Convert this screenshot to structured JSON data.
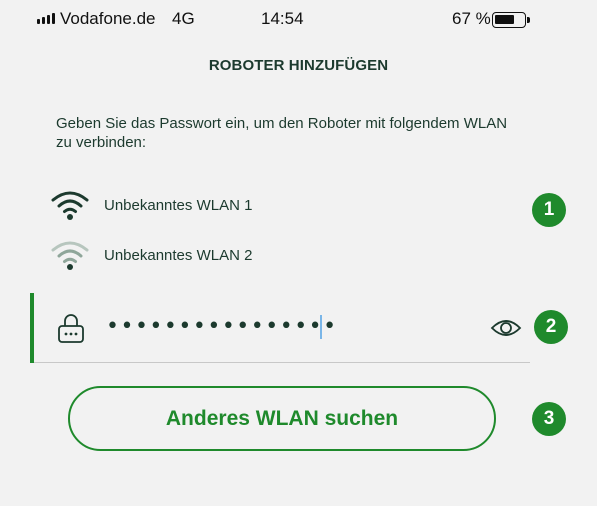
{
  "status_bar": {
    "carrier": "Vodafone.de",
    "network": "4G",
    "time": "14:54",
    "battery_percent": "67 %",
    "battery_level": 0.67
  },
  "header": {
    "title": "ROBOTER HINZUFÜGEN"
  },
  "instruction": "Geben Sie das Passwort ein, um den Roboter mit folgendem WLAN zu verbinden:",
  "networks": [
    {
      "label": "Unbekanntes WLAN 1",
      "icon": "wifi-icon",
      "selected": true
    },
    {
      "label": "Unbekanntes WLAN 2",
      "icon": "wifi-icon",
      "selected": false
    }
  ],
  "password_field": {
    "value": "••••••••••••••••",
    "lock_icon": "lock-icon",
    "toggle_icon": "eye-icon"
  },
  "actions": {
    "search_other_wlan": "Anderes WLAN suchen"
  },
  "badges": [
    "1",
    "2",
    "3"
  ],
  "colors": {
    "accent": "#1f8a2c",
    "text": "#1c3a2e",
    "wifi_active": "#1c3a2e",
    "wifi_inactive": "#8fa69a",
    "background": "#f2f2f2"
  }
}
